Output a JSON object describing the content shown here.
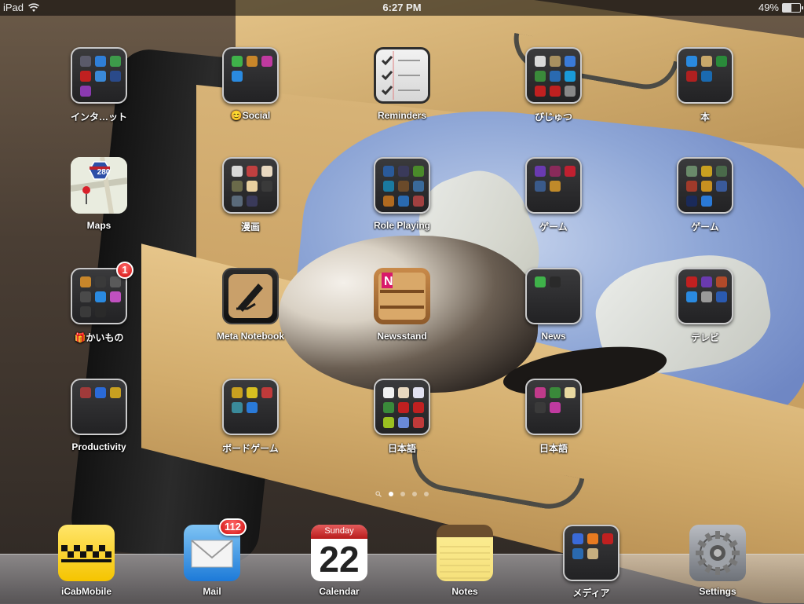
{
  "status_bar": {
    "device": "iPad",
    "time": "6:27 PM",
    "battery": "49%",
    "battery_level": 0.49
  },
  "home": {
    "rows": [
      [
        {
          "type": "folder",
          "label": "インタ…ット",
          "icon": "folder-icon",
          "mini": [
            "#5a5a6a",
            "#2f7fd8",
            "#3d9a4a",
            "#c02020",
            "#3a8ad8",
            "#2a4a8a",
            "#8a3ab0"
          ]
        },
        {
          "type": "folder",
          "label": "Social",
          "label_prefix": "😊",
          "icon": "folder-icon",
          "mini": [
            "#3fb24a",
            "#c8862a",
            "#c03aa0",
            "#2a8ae0"
          ]
        },
        {
          "type": "app",
          "label": "Reminders",
          "icon": "reminders-icon"
        },
        {
          "type": "folder",
          "label": "びじゅつ",
          "icon": "folder-icon",
          "mini": [
            "#d8d8d8",
            "#a89060",
            "#3a7ad8",
            "#3a8a3a",
            "#2a6ab0",
            "#1a9ad8",
            "#c02020",
            "#c02020",
            "#888888"
          ]
        },
        {
          "type": "folder",
          "label": "本",
          "icon": "folder-icon",
          "mini": [
            "#2a8ae0",
            "#c8a86a",
            "#2a8a3a",
            "#b02020",
            "#1a6ab0"
          ]
        }
      ],
      [
        {
          "type": "app",
          "label": "Maps",
          "icon": "maps-icon",
          "badge_text": "280"
        },
        {
          "type": "folder",
          "label": "漫画",
          "icon": "folder-icon",
          "mini": [
            "#d8d8d8",
            "#c04040",
            "#e8d8c0",
            "#6a6a4a",
            "#e8d0a0",
            "#3a3a3a",
            "#5a6a7a",
            "#3a3a5a"
          ]
        },
        {
          "type": "folder",
          "label": "Role Playing",
          "icon": "folder-icon",
          "mini": [
            "#2a5a9a",
            "#3a3a5a",
            "#4a8a2a",
            "#1a7aa0",
            "#6a4a2a",
            "#3a6a9a",
            "#b06a20",
            "#2a6ab0",
            "#a04040"
          ]
        },
        {
          "type": "folder",
          "label": "ゲーム",
          "icon": "folder-icon",
          "mini": [
            "#6a3ab0",
            "#8a2a5a",
            "#c02030",
            "#3a5a8a",
            "#c08a2a"
          ]
        },
        {
          "type": "folder",
          "label": "ゲーム",
          "icon": "folder-icon",
          "mini": [
            "#6a8a6a",
            "#c8a020",
            "#4a6a4a",
            "#a03a2a",
            "#c89020",
            "#3a5a9a",
            "#1a2a5a",
            "#2a7ad8"
          ]
        }
      ],
      [
        {
          "type": "folder",
          "label": "かいもの",
          "label_prefix": "🎁",
          "icon": "folder-icon",
          "badge": "1",
          "mini": [
            "#c8862a",
            "#3a3a3a",
            "#5a5a5a",
            "#4a4a4a",
            "#2a8ae0",
            "#c050c0",
            "#3a3a3a",
            "#2a2a2a"
          ]
        },
        {
          "type": "app",
          "label": "Meta Notebook",
          "icon": "meta-notebook-icon"
        },
        {
          "type": "app",
          "label": "Newsstand",
          "icon": "newsstand-icon"
        },
        {
          "type": "folder",
          "label": "News",
          "icon": "folder-icon",
          "mini": [
            "#3fb24a",
            "#2a2a2a"
          ]
        },
        {
          "type": "folder",
          "label": "テレビ",
          "icon": "folder-icon",
          "mini": [
            "#c02020",
            "#6a3ab0",
            "#b04a2a",
            "#2a8ae0",
            "#9a9a9a",
            "#2a5ab0"
          ]
        }
      ],
      [
        {
          "type": "folder",
          "label": "Productivity",
          "icon": "folder-icon",
          "mini": [
            "#a03a3a",
            "#2a6ad8",
            "#c8a020"
          ]
        },
        {
          "type": "folder",
          "label": "ボードゲーム",
          "icon": "folder-icon",
          "mini": [
            "#c8a020",
            "#d8c020",
            "#c03a3a",
            "#3a8a9a",
            "#2a7ad8"
          ]
        },
        {
          "type": "folder",
          "label": "日本語",
          "icon": "folder-icon",
          "mini": [
            "#f0f0f0",
            "#e8d8c0",
            "#e0e0f0",
            "#3a8a3a",
            "#c02020",
            "#c02020",
            "#9ac020",
            "#6a8ad8",
            "#c03a3a"
          ]
        },
        {
          "type": "folder",
          "label": "日本語",
          "icon": "folder-icon",
          "mini": [
            "#c03a8a",
            "#3a8a3a",
            "#e8d8a0",
            "#3a3a3a",
            "#c03aa0"
          ]
        }
      ]
    ]
  },
  "page_dots": {
    "count": 4,
    "active": 0
  },
  "dock": [
    {
      "type": "app",
      "label": "iCabMobile",
      "icon": "icab-taxi-icon"
    },
    {
      "type": "app",
      "label": "Mail",
      "icon": "mail-envelope-icon",
      "badge": "112"
    },
    {
      "type": "app",
      "label": "Calendar",
      "icon": "calendar-icon",
      "weekday": "Sunday",
      "day": "22"
    },
    {
      "type": "app",
      "label": "Notes",
      "icon": "notes-icon"
    },
    {
      "type": "folder",
      "label": "メディア",
      "icon": "folder-icon",
      "mini": [
        "#3a6ad8",
        "#e87a20",
        "#c02020",
        "#2a6ab0",
        "#c8b080"
      ]
    },
    {
      "type": "app",
      "label": "Settings",
      "icon": "settings-gear-icon"
    }
  ]
}
